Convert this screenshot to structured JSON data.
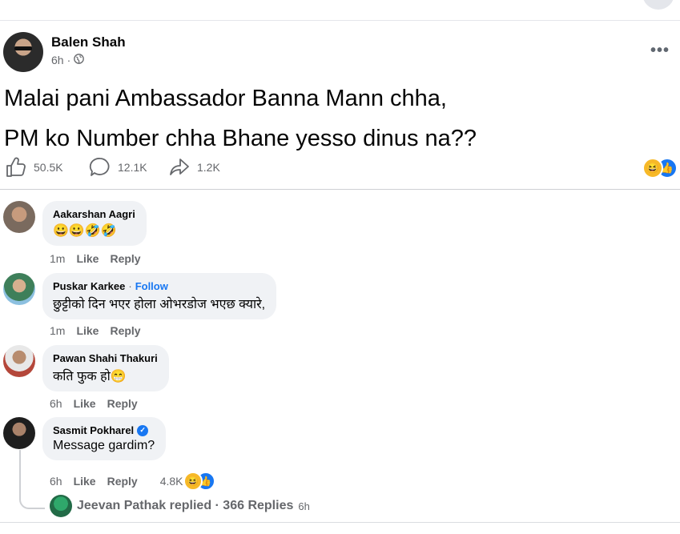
{
  "post": {
    "author": "Balen Shah",
    "time": "6h",
    "privacy_icon": "globe-icon",
    "line1": "Malai pani Ambassador Banna Mann chha,",
    "line2": "PM ko Number chha Bhane yesso dinus na??",
    "likes": "50.5K",
    "comments": "12.1K",
    "shares": "1.2K",
    "reactions": [
      "haha",
      "like"
    ]
  },
  "comments": [
    {
      "name": "Aakarshan Aagri",
      "text": "😀😀🤣🤣",
      "time": "1m",
      "like": "Like",
      "reply": "Reply"
    },
    {
      "name": "Puskar Karkee",
      "follow": "Follow",
      "text": "छुट्टीको दिन भएर होला ओभरडोज भएछ क्यारे,",
      "time": "1m",
      "like": "Like",
      "reply": "Reply"
    },
    {
      "name": "Pawan Shahi Thakuri",
      "text": "कति फुक हो😁",
      "time": "6h",
      "like": "Like",
      "reply": "Reply"
    },
    {
      "name": "Sasmit Pokharel",
      "verified": true,
      "text": "Message gardim?",
      "time": "6h",
      "like": "Like",
      "reply": "Reply",
      "reaction_count": "4.8K"
    }
  ],
  "replies_summary": {
    "text": "Jeevan Pathak replied · 366 Replies",
    "time": "6h"
  },
  "colors": {
    "accent": "#1877f2",
    "bubble": "#f0f2f5",
    "muted": "#65676b"
  }
}
